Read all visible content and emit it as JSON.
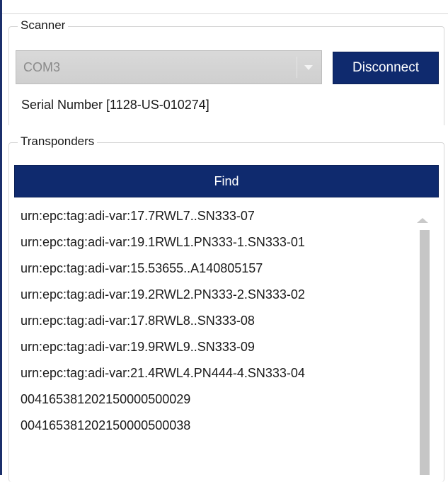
{
  "scanner": {
    "title": "Scanner",
    "port_value": "COM3",
    "disconnect_label": "Disconnect",
    "serial_text": "Serial Number [1128-US-010274]"
  },
  "transponders": {
    "title": "Transponders",
    "find_label": "Find",
    "items": [
      "urn:epc:tag:adi-var:17.7RWL7..SN333-07",
      "urn:epc:tag:adi-var:19.1RWL1.PN333-1.SN333-01",
      "urn:epc:tag:adi-var:15.53655..A140805157",
      "urn:epc:tag:adi-var:19.2RWL2.PN333-2.SN333-02",
      "urn:epc:tag:adi-var:17.8RWL8..SN333-08",
      "urn:epc:tag:adi-var:19.9RWL9..SN333-09",
      "urn:epc:tag:adi-var:21.4RWL4.PN444-4.SN333-04",
      "004165381202150000500029",
      "004165381202150000500038"
    ]
  }
}
